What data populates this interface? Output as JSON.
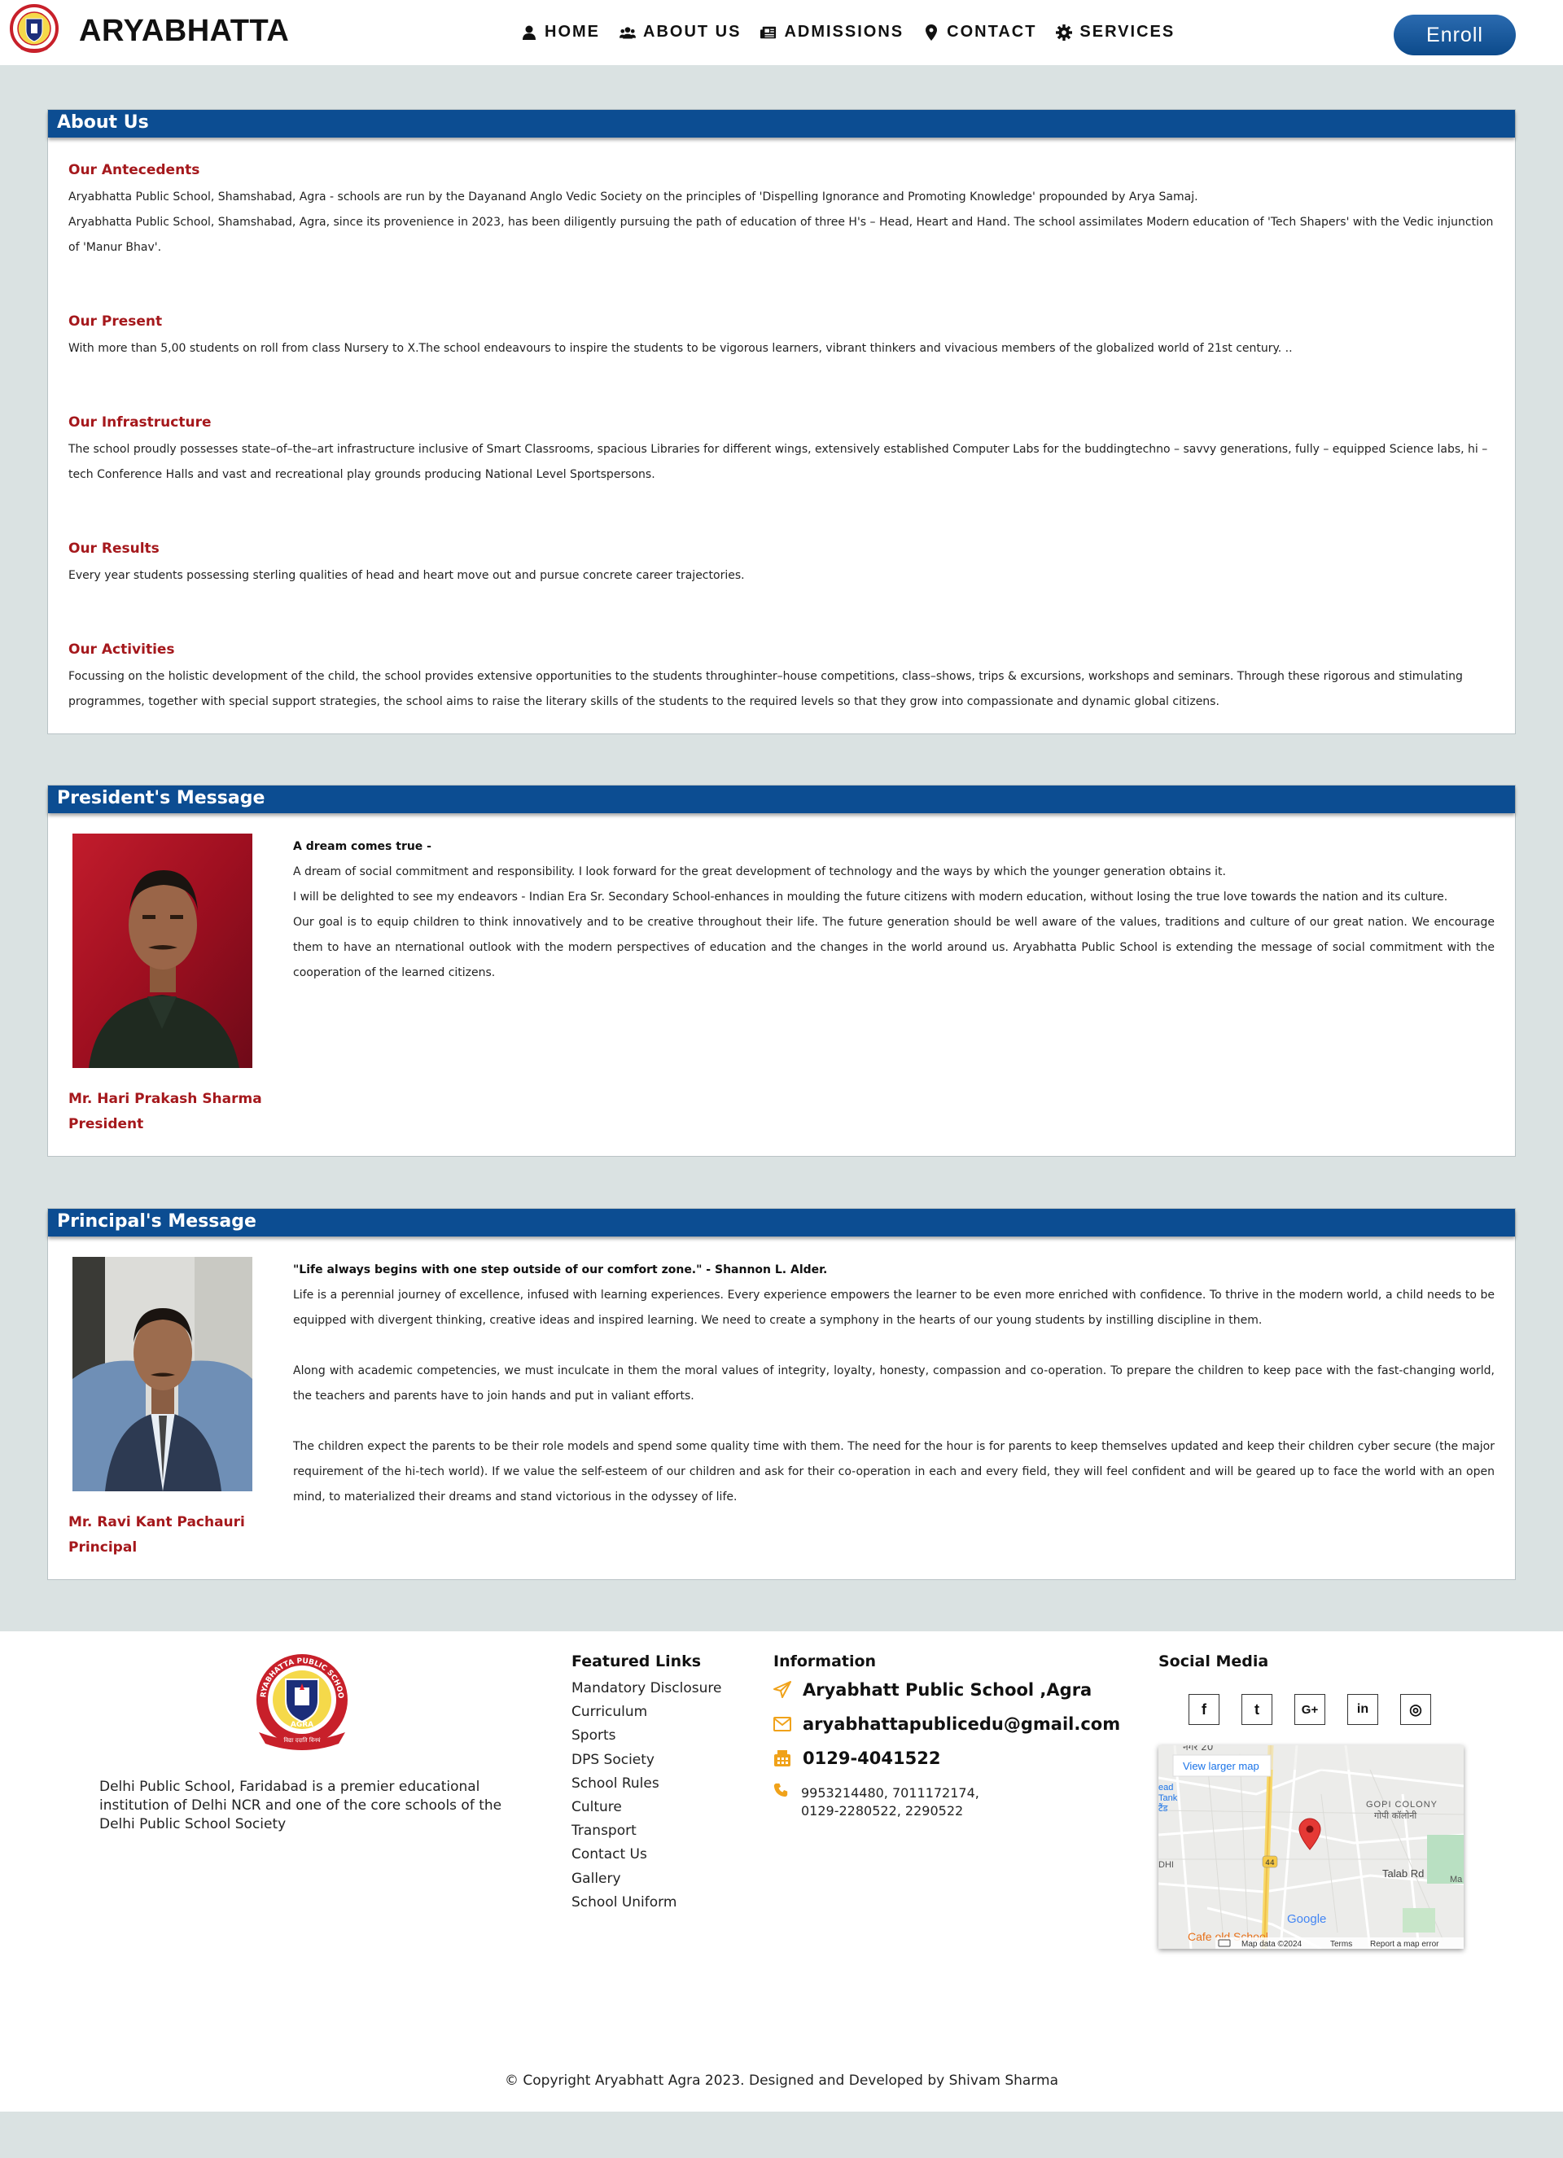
{
  "header": {
    "brand": "ARYABHATTA",
    "nav": [
      {
        "label": "HOME",
        "icon": "user-icon"
      },
      {
        "label": "ABOUT US",
        "icon": "users-icon"
      },
      {
        "label": "ADMISSIONS",
        "icon": "newspaper-icon"
      },
      {
        "label": "CONTACT",
        "icon": "map-marker-icon"
      },
      {
        "label": "SERVICES",
        "icon": "gear-icon"
      }
    ],
    "enroll_label": "Enroll"
  },
  "about": {
    "heading": "About Us",
    "sections": [
      {
        "title": "Our Antecedents",
        "paragraphs": [
          "Aryabhatta Public School, Shamshabad, Agra - schools are run by the Dayanand Anglo Vedic Society on the principles of 'Dispelling Ignorance and Promoting Knowledge' propounded by Arya Samaj.",
          "Aryabhatta Public School, Shamshabad, Agra, since its provenience in 2023, has been diligently pursuing the path of education of three H's – Head, Heart and Hand. The school assimilates Modern education of 'Tech Shapers' with the Vedic injunction of 'Manur Bhav'."
        ]
      },
      {
        "title": "Our Present",
        "paragraphs": [
          "With more than 5,00 students on roll from class Nursery to X.The school endeavours to inspire the students to be vigorous learners, vibrant thinkers and vivacious members of the globalized world of 21st century. .."
        ]
      },
      {
        "title": "Our Infrastructure",
        "paragraphs": [
          "The school proudly possesses state–of–the–art infrastructure inclusive of Smart Classrooms, spacious Libraries for different wings, extensively established Computer Labs for the buddingtechno – savvy generations, fully – equipped Science labs, hi – tech Conference Halls and vast and recreational play grounds producing National Level Sportspersons."
        ]
      },
      {
        "title": "Our Results",
        "paragraphs": [
          "Every year students possessing sterling qualities of head and heart move out and pursue concrete career trajectories."
        ]
      },
      {
        "title": "Our Activities",
        "paragraphs": [
          "Focussing on the holistic development of the child, the school provides extensive opportunities to the students throughinter–house competitions, class–shows, trips & excursions, workshops and seminars. Through these rigorous and stimulating programmes, together with special support strategies, the school aims to raise the literary skills of the students to the required levels so that they grow into compassionate and dynamic global citizens."
        ]
      }
    ]
  },
  "president": {
    "heading": "President's Message",
    "lead": "A dream comes true -",
    "paragraphs": [
      "A dream of social commitment and responsibility. I look forward for the great development of technology and the ways by which the younger generation obtains it.",
      "I will be delighted to see my endeavors - Indian Era Sr. Secondary School-enhances in moulding the future citizens with modern education, without losing the true love towards the nation and its culture.",
      "Our goal is to equip children to think innovatively and to be creative throughout their life. The future generation should be well aware of the values, traditions and culture of our great nation. We encourage them to have an nternational outlook with the modern perspectives of education and the changes in the world around us. Aryabhatta Public School is extending the message of social commitment with the cooperation of the learned citizens."
    ],
    "name": "Mr. Hari Prakash Sharma",
    "role": "President"
  },
  "principal": {
    "heading": "Principal's Message",
    "lead": "\"Life always begins with one step outside of our comfort zone.\" - Shannon L. Alder.",
    "paragraphs": [
      "Life is a perennial journey of excellence, infused with learning experiences. Every experience empowers the learner to be even more enriched with confidence. To thrive in the modern world, a child needs to be equipped with divergent thinking, creative ideas and inspired learning. We need to create a symphony in the hearts of our young students by instilling discipline in them.",
      "Along with academic competencies, we must inculcate in them the moral values of integrity, loyalty, honesty, compassion and co-operation. To prepare the children to keep pace with the fast-changing world, the teachers and parents have to join hands and put in valiant efforts.",
      "The children expect the parents to be their role models and spend some quality time with them. The need for the hour is for parents to keep themselves updated and keep their children cyber secure (the major requirement of the hi-tech world). If we value the self-esteem of our children and ask for their co-operation in each and every field, they will feel confident and will be geared up to face the world with an open mind, to materialized their dreams and stand victorious in the odyssey of life."
    ],
    "name": "Mr. Ravi Kant Pachauri",
    "role": "Principal"
  },
  "footer": {
    "logo_text": {
      "top": "ARYABHATTA PUBLIC SCHOOL",
      "bottom": "AGRA",
      "motto": "विद्या ददाति विनयं"
    },
    "description": "Delhi Public School, Faridabad is a premier educational institution of Delhi NCR and one of the core schools of the Delhi Public School Society",
    "featured_title": "Featured Links",
    "links": [
      "Mandatory Disclosure",
      "Curriculum",
      "Sports",
      "DPS Society",
      "School Rules",
      "Culture",
      "Transport",
      "Contact Us",
      "Gallery",
      "School Uniform"
    ],
    "info_title": "Information",
    "info": {
      "address": "Aryabhatt Public School ,Agra",
      "email": "aryabhattapublicedu@gmail.com",
      "fax": "0129-4041522",
      "phones_line1": "9953214480, 7011172174,",
      "phones_line2": "0129-2280522, 2290522"
    },
    "social_title": "Social Media",
    "social": [
      {
        "glyph": "f",
        "icon": "facebook-icon"
      },
      {
        "glyph": "t",
        "icon": "twitter-icon"
      },
      {
        "glyph": "G+",
        "icon": "google-plus-icon"
      },
      {
        "glyph": "in",
        "icon": "linkedin-icon"
      },
      {
        "glyph": "◎",
        "icon": "instagram-icon"
      }
    ],
    "map": {
      "view_larger": "View larger map",
      "area_label1": "GOPI COLONY",
      "area_label2": "गोपी कॉलोनी",
      "road_label": "Talab Rd",
      "highway": "44",
      "place": "Cafe old School",
      "google": "Google",
      "map_data": "Map data ©2024",
      "terms": "Terms",
      "report": "Report a map error",
      "edge1": "ead",
      "edge2": "Tank",
      "edge3": "टैंड",
      "edge4": "DHI",
      "edge5": "Ma",
      "top_clip": "नगर 20"
    },
    "copyright": "© Copyright Aryabhatt Agra 2023. Designed and Developed by Shivam Sharma"
  }
}
